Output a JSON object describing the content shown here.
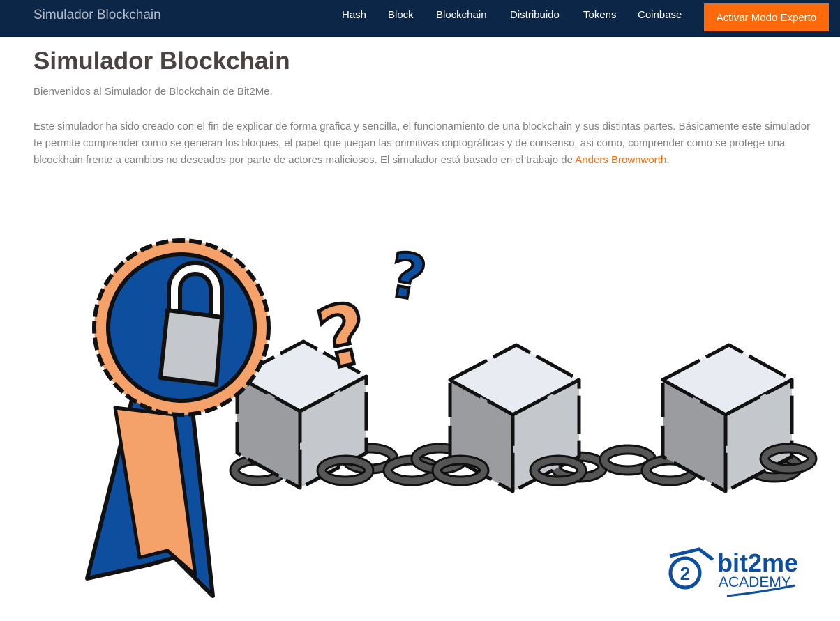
{
  "navbar": {
    "brand": "Simulador Blockchain",
    "links": [
      {
        "label": "Hash"
      },
      {
        "label": "Block"
      },
      {
        "label": "Blockchain"
      },
      {
        "label": "Distribuido"
      },
      {
        "label": "Tokens"
      },
      {
        "label": "Coinbase"
      }
    ],
    "expert_button": "Activar Modo Experto"
  },
  "main": {
    "title": "Simulador Blockchain",
    "welcome": "Bienvenidos al Simulador de Blockchain de Bit2Me.",
    "intro_text": "Este simulador ha sido creado con el fin de explicar de forma grafica y sencilla, el funcionamiento de una blockchain y sus distintas partes. Básicamente este simulador te permite comprender como se generan los bloques, el papel que juegan las primitivas criptográficas y de consenso, asi como, comprender como se protege una blcockhain frente a cambios no deseados por parte de actores maliciosos. El simulador está basado en el trabajo de",
    "author_link": "Anders Brownworth."
  },
  "illustration": {
    "logo_name": "bit2me",
    "logo_sub": "ACADEMY",
    "logo_badge": "2"
  },
  "colors": {
    "navbar_bg": "#0c2647",
    "accent": "#fe6a0a",
    "badge_blue": "#0d4f9e",
    "badge_orange": "#f4a26a",
    "cube_light": "#e8ebf2",
    "cube_mid": "#c4c7cc",
    "cube_dark": "#9a9ca0",
    "chain": "#555555"
  }
}
